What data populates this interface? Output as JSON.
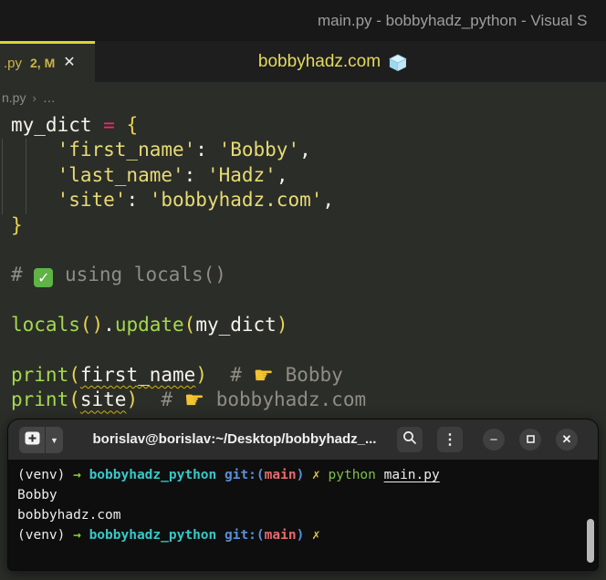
{
  "window": {
    "title": "main.py - bobbyhadz_python - Visual S"
  },
  "tab_bar": {
    "active_tab": {
      "label": ".py",
      "badge": "2, M"
    },
    "watermark": {
      "text": "bobbyhadz.com",
      "emoji": "ice-cube"
    }
  },
  "breadcrumb": {
    "file": "n.py",
    "separator": "›",
    "more": "…"
  },
  "editor": {
    "code_lines": [
      [
        {
          "t": "my_dict ",
          "c": "txt"
        },
        {
          "t": "= ",
          "c": "pink"
        },
        {
          "t": "{",
          "c": "gold"
        }
      ],
      [
        {
          "t": "    ",
          "c": "txt"
        },
        {
          "t": "'first_name'",
          "c": "str"
        },
        {
          "t": ": ",
          "c": "txt"
        },
        {
          "t": "'Bobby'",
          "c": "str"
        },
        {
          "t": ",",
          "c": "txt"
        }
      ],
      [
        {
          "t": "    ",
          "c": "txt"
        },
        {
          "t": "'last_name'",
          "c": "str"
        },
        {
          "t": ": ",
          "c": "txt"
        },
        {
          "t": "'Hadz'",
          "c": "str"
        },
        {
          "t": ",",
          "c": "txt"
        }
      ],
      [
        {
          "t": "    ",
          "c": "txt"
        },
        {
          "t": "'site'",
          "c": "str"
        },
        {
          "t": ": ",
          "c": "txt"
        },
        {
          "t": "'bobbyhadz.com'",
          "c": "str"
        },
        {
          "t": ",",
          "c": "txt"
        }
      ],
      [
        {
          "t": "}",
          "c": "gold"
        }
      ],
      [],
      [
        {
          "t": "# ",
          "c": "cmt"
        },
        {
          "e": "check"
        },
        {
          "t": " using locals()",
          "c": "cmt"
        }
      ],
      [],
      [
        {
          "t": "locals",
          "c": "fn"
        },
        {
          "t": "()",
          "c": "gold"
        },
        {
          "t": ".",
          "c": "txt"
        },
        {
          "t": "update",
          "c": "fn"
        },
        {
          "t": "(",
          "c": "gold"
        },
        {
          "t": "my_dict",
          "c": "txt"
        },
        {
          "t": ")",
          "c": "gold"
        }
      ],
      [],
      [
        {
          "t": "print",
          "c": "fn"
        },
        {
          "t": "(",
          "c": "gold"
        },
        {
          "t": "first_name",
          "c": "txt",
          "u": 1
        },
        {
          "t": ")",
          "c": "gold"
        },
        {
          "t": "  # ",
          "c": "cmt"
        },
        {
          "e": "point"
        },
        {
          "t": " Bobby",
          "c": "cmt"
        }
      ],
      [
        {
          "t": "print",
          "c": "fn"
        },
        {
          "t": "(",
          "c": "gold"
        },
        {
          "t": "site",
          "c": "txt",
          "u": 1
        },
        {
          "t": ")",
          "c": "gold"
        },
        {
          "t": "  # ",
          "c": "cmt"
        },
        {
          "e": "point"
        },
        {
          "t": " bobbyhadz.com",
          "c": "cmt"
        }
      ]
    ]
  },
  "terminal": {
    "header": {
      "title": "borislav@borislav:~/Desktop/bobbyhadz_..."
    },
    "lines": [
      [
        {
          "t": "(venv) ",
          "c": "tw"
        },
        {
          "t": "→ ",
          "c": "tgreen",
          "b": 1
        },
        {
          "t": "bobbyhadz_python ",
          "c": "tcyan",
          "b": 1
        },
        {
          "t": "git:(",
          "c": "tblue",
          "b": 1
        },
        {
          "t": "main",
          "c": "tred",
          "b": 1
        },
        {
          "t": ") ",
          "c": "tblue",
          "b": 1
        },
        {
          "t": "✗ ",
          "c": "tyellow",
          "b": 1
        },
        {
          "t": "python ",
          "c": "tgreen2"
        },
        {
          "t": "main.py",
          "c": "tw",
          "ul": 1
        }
      ],
      [
        {
          "t": "Bobby",
          "c": "tw"
        }
      ],
      [
        {
          "t": "bobbyhadz.com",
          "c": "tw"
        }
      ],
      [
        {
          "t": "(venv) ",
          "c": "tw"
        },
        {
          "t": "→ ",
          "c": "tgreen",
          "b": 1
        },
        {
          "t": "bobbyhadz_python ",
          "c": "tcyan",
          "b": 1
        },
        {
          "t": "git:(",
          "c": "tblue",
          "b": 1
        },
        {
          "t": "main",
          "c": "tred",
          "b": 1
        },
        {
          "t": ") ",
          "c": "tblue",
          "b": 1
        },
        {
          "t": "✗",
          "c": "tyellow",
          "b": 1
        }
      ]
    ]
  },
  "glyphs": {
    "tab_close": "✕",
    "close": "✕",
    "minimize": "−",
    "kebab": "⋮",
    "dropdown": "▼",
    "check": "✓",
    "pointer": "☛"
  },
  "icons": [
    "new-tab-icon",
    "dropdown-icon",
    "search-icon",
    "kebab-menu-icon",
    "minimize-icon",
    "maximize-icon",
    "close-icon",
    "check-emoji",
    "pointing-right-emoji",
    "ice-cube-emoji"
  ],
  "colors": {
    "titlebar_bg": "#181818",
    "tabbar_bg": "#1e1e1e",
    "tab_active_bg": "#2b2d29",
    "tab_accent": "#ddd32e",
    "tab_label": "#ccb347",
    "editor_bg": "#2b2d29",
    "code_text": "#f5f3ea",
    "string": "#e6db74",
    "operator_pink": "#f92672",
    "bracket_gold": "#e8d44d",
    "function_green": "#a3d94c",
    "comment": "#8f8d84",
    "squiggle": "#d3b60a",
    "watermark": "#e4da5d",
    "term_header_bg": "#2d2d2d",
    "term_bg": "#0e0e0e",
    "term_white": "#ececec",
    "term_green": "#82d135",
    "term_cyan": "#35c9c9",
    "term_blue": "#5b8fd6",
    "term_red": "#e66a6e",
    "term_yellow": "#e0c341",
    "term_green2": "#7fbf4a"
  }
}
